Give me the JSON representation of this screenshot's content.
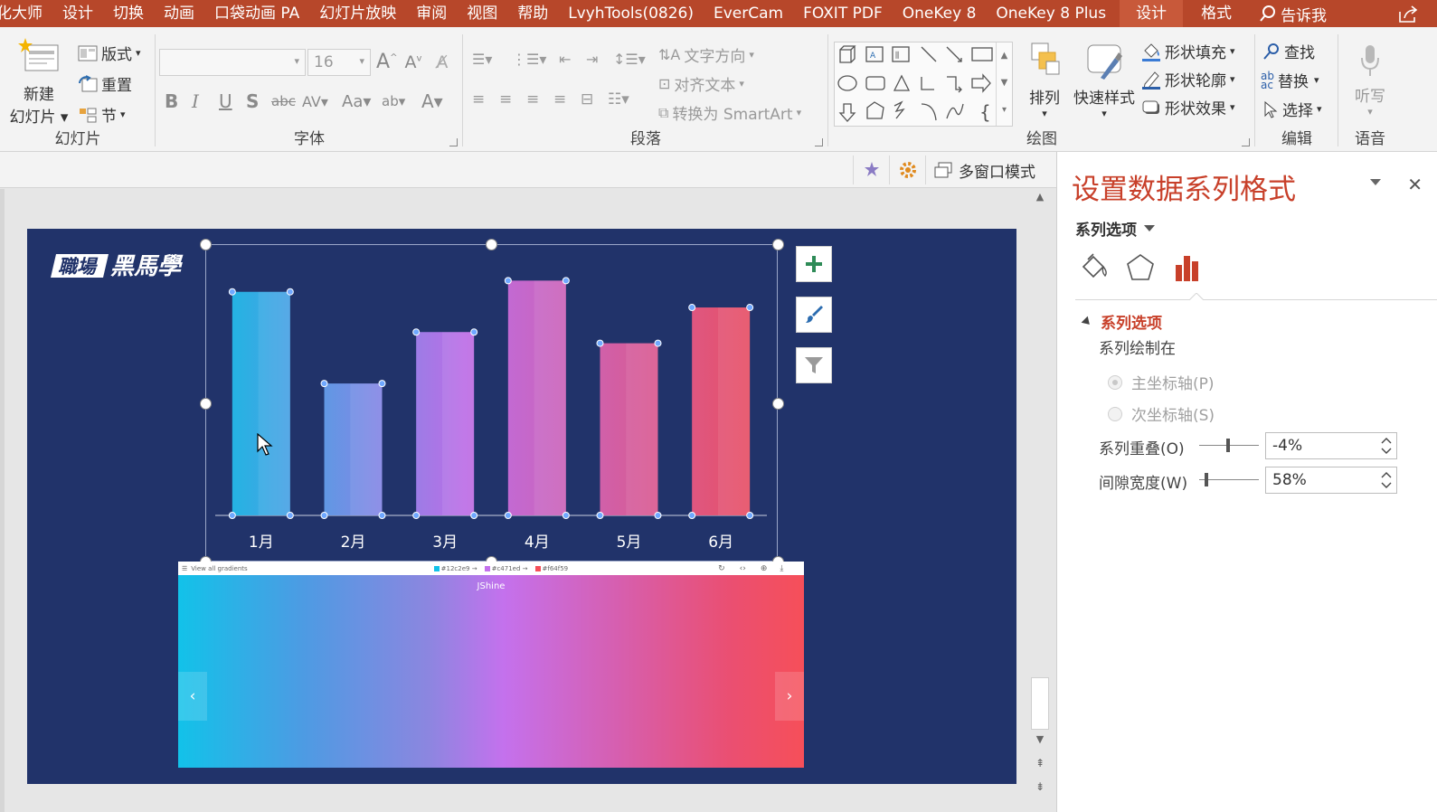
{
  "menu": {
    "tabs": [
      "化大师",
      "设计",
      "切换",
      "动画",
      "口袋动画 PA",
      "幻灯片放映",
      "审阅",
      "视图",
      "帮助",
      "LvyhTools(0826)",
      "EverCam",
      "FOXIT PDF",
      "OneKey 8",
      "OneKey 8 Plus"
    ],
    "context_tabs": [
      "设计",
      "格式"
    ],
    "tell_me": "告诉我"
  },
  "ribbon": {
    "slides": {
      "new_slide_line1": "新建",
      "new_slide_line2": "幻灯片",
      "layout": "版式",
      "reset": "重置",
      "section": "节",
      "label": "幻灯片"
    },
    "font": {
      "font_name": "",
      "font_size": "16",
      "label": "字体"
    },
    "paragraph": {
      "text_direction": "文字方向",
      "align_text": "对齐文本",
      "convert_smartart": "转换为 SmartArt",
      "label": "段落"
    },
    "drawing": {
      "arrange": "排列",
      "quick_styles": "快速样式",
      "shape_fill": "形状填充",
      "shape_outline": "形状轮廓",
      "shape_effects": "形状效果",
      "label": "绘图"
    },
    "editing": {
      "find": "查找",
      "replace": "替换",
      "select": "选择",
      "label": "编辑"
    },
    "voice": {
      "dictate": "听写",
      "label": "语音"
    }
  },
  "subbar": {
    "multi_window": "多窗口模式"
  },
  "slide": {
    "logo_text": "職場黑馬學",
    "gradient": {
      "topbar_text": "View all gradients",
      "colors": [
        "#12c2e9",
        "#c471ed",
        "#f64f59"
      ],
      "color_labels": [
        "#12c2e9 →",
        "#c471ed →",
        "#f64f59"
      ],
      "name": "JShine",
      "prev": "‹",
      "next": "›"
    }
  },
  "chart_data": {
    "type": "bar",
    "categories": [
      "1月",
      "2月",
      "3月",
      "4月",
      "5月",
      "6月"
    ],
    "values": [
      100,
      59,
      82,
      105,
      77,
      93
    ],
    "ylim": [
      0,
      110
    ],
    "series_overlap": "-4%",
    "gap_width": "58%"
  },
  "pane": {
    "title": "设置数据系列格式",
    "series_options_dropdown": "系列选项",
    "section": "系列选项",
    "plot_on": "系列绘制在",
    "primary_axis": "主坐标轴(P)",
    "secondary_axis": "次坐标轴(S)",
    "overlap_label": "系列重叠(O)",
    "overlap_value": "-4%",
    "gap_label": "间隙宽度(W)",
    "gap_value": "58%",
    "overlap_fraction": 0.48,
    "gap_fraction": 0.1
  }
}
